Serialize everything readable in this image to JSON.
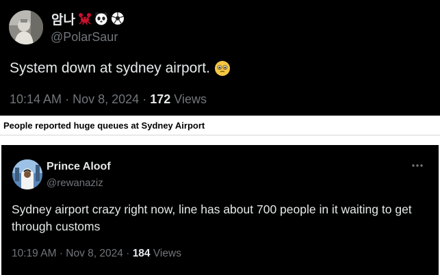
{
  "tweet1": {
    "display_name": "암나",
    "name_emoji_icons": [
      "crab-icon",
      "panda-icon",
      "soccer-ball-icon"
    ],
    "handle": "@PolarSaur",
    "body": "System down at sydney airport.",
    "body_emoji_icon": "holding-back-tears-face-icon",
    "time": "10:14 AM",
    "separator": "·",
    "date": "Nov 8, 2024",
    "views_count": "172",
    "views_label": "Views"
  },
  "caption": "People reported huge queues at Sydney Airport",
  "tweet2": {
    "display_name": "Prince Aloof",
    "handle": "@rewanaziz",
    "more_icon": "more-horizontal-icon",
    "body": "Sydney airport crazy right now, line has about 700 people in it waiting to get through customs",
    "time": "10:19 AM",
    "separator": "·",
    "date": "Nov 8, 2024",
    "views_count": "184",
    "views_label": "Views"
  },
  "colors": {
    "tweet_background": "#000000",
    "primary_text": "#e7e9ea",
    "secondary_text": "#71767b",
    "page_background": "#ffffff"
  }
}
